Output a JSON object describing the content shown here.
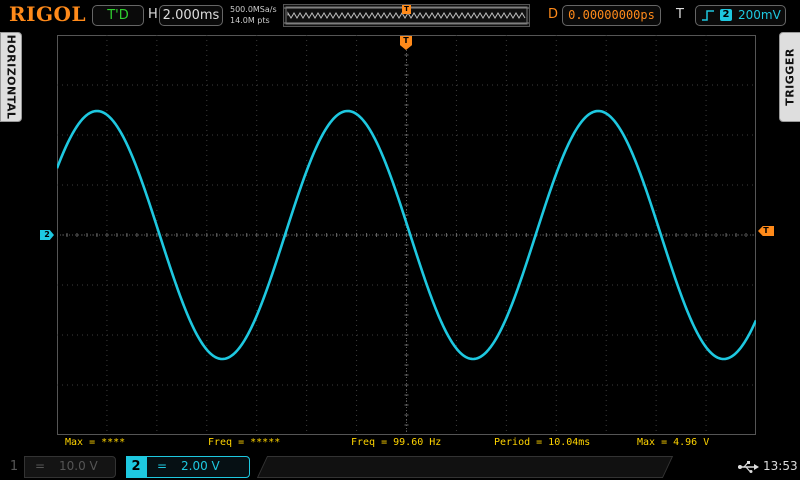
{
  "header": {
    "brand": "RIGOL",
    "run_state": "T'D",
    "h_label": "H",
    "timebase": "2.000ms",
    "sample_rate": "500.0MSa/s",
    "memory_depth": "14.0M pts",
    "delay_label": "D",
    "delay": "0.00000000ps",
    "trigger_label": "T",
    "trigger_source": "2",
    "trigger_level": "200mV",
    "trigger_marker": "T"
  },
  "tabs": {
    "left": "HORIZONTAL",
    "right": "TRIGGER"
  },
  "markers": {
    "channel": "2",
    "trigger_level": "T",
    "trigger_position": "T"
  },
  "measurements": [
    "Max = ****",
    "Freq = *****",
    "Freq = 99.60 Hz",
    "Period = 10.04ms",
    "Max = 4.96 V"
  ],
  "channels": [
    {
      "number": "1",
      "coupling": "=",
      "scale": "10.0 V",
      "active": false
    },
    {
      "number": "2",
      "coupling": "=",
      "scale": "2.00 V",
      "active": true
    }
  ],
  "status": {
    "time": "13:53"
  },
  "colors": {
    "brand": "#ff8a1a",
    "ch2": "#1ec8e0",
    "trigger": "#ff8a1a",
    "measure": "#ffd400",
    "run": "#2fd02f"
  },
  "icons": [
    "trigger-rising-edge-icon",
    "usb-icon"
  ],
  "waveform": {
    "channel": "2",
    "frequency_hz": 99.6,
    "period_ms": 10.04,
    "max_v": 4.96,
    "volts_per_div": 2.0,
    "time_per_div_ms": 2.0
  }
}
